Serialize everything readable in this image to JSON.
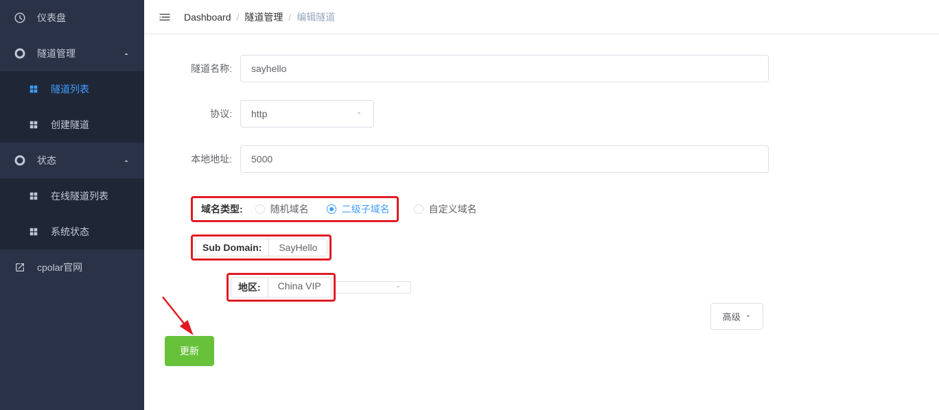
{
  "sidebar": {
    "items": [
      {
        "label": "仪表盘"
      },
      {
        "label": "隧道管理"
      },
      {
        "label": "隧道列表"
      },
      {
        "label": "创建隧道"
      },
      {
        "label": "状态"
      },
      {
        "label": "在线隧道列表"
      },
      {
        "label": "系统状态"
      },
      {
        "label": "cpolar官网"
      }
    ]
  },
  "breadcrumb": {
    "items": [
      "Dashboard",
      "隧道管理",
      "编辑隧道"
    ]
  },
  "form": {
    "tunnel_name_label": "隧道名称:",
    "tunnel_name_value": "sayhello",
    "protocol_label": "协议:",
    "protocol_value": "http",
    "local_addr_label": "本地地址:",
    "local_addr_value": "5000",
    "domain_type_label": "域名类型:",
    "domain_type_options": {
      "random": "随机域名",
      "subdomain": "二级子域名",
      "custom": "自定义域名"
    },
    "domain_type_selected": "subdomain",
    "subdomain_label": "Sub Domain:",
    "subdomain_value": "SayHello",
    "region_label": "地区:",
    "region_value": "China VIP",
    "advanced_label": "高级",
    "update_label": "更新"
  }
}
